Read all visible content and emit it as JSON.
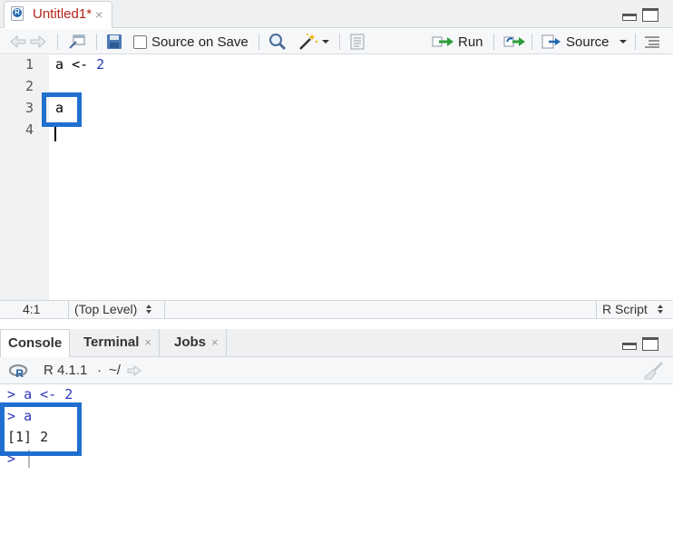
{
  "editor": {
    "tab_title": "Untitled1*",
    "tab_close": "×",
    "file_icon_letter": "R",
    "toolbar": {
      "source_on_save": "Source on Save",
      "run": "Run",
      "source": "Source"
    },
    "lines": [
      {
        "number": "1",
        "tokens": {
          "ident": "a",
          "op": "<-",
          "num": "2"
        }
      },
      {
        "number": "2",
        "text": ""
      },
      {
        "number": "3",
        "text": "a"
      },
      {
        "number": "4",
        "text": ""
      }
    ],
    "status": {
      "position": "4:1",
      "scope": "(Top Level)",
      "file_type": "R Script"
    }
  },
  "console": {
    "tabs": [
      {
        "label": "Console",
        "active": true
      },
      {
        "label": "Terminal",
        "close": "×"
      },
      {
        "label": "Jobs",
        "close": "×"
      }
    ],
    "r_version": "R 4.1.1",
    "separator": "·",
    "working_dir": "~/",
    "lines": [
      {
        "prompt": ">",
        "code": "a <- 2"
      },
      {
        "prompt": ">",
        "code": "a"
      },
      {
        "output": "[1] 2"
      },
      {
        "prompt": ">",
        "code": ""
      }
    ]
  },
  "colors": {
    "highlight_box": "#1f6fcf",
    "tab_title_modified": "#b3241b",
    "console_input": "#2a37b8",
    "number_literal": "#2a37b8",
    "run_arrow": "#2e9e3a"
  }
}
